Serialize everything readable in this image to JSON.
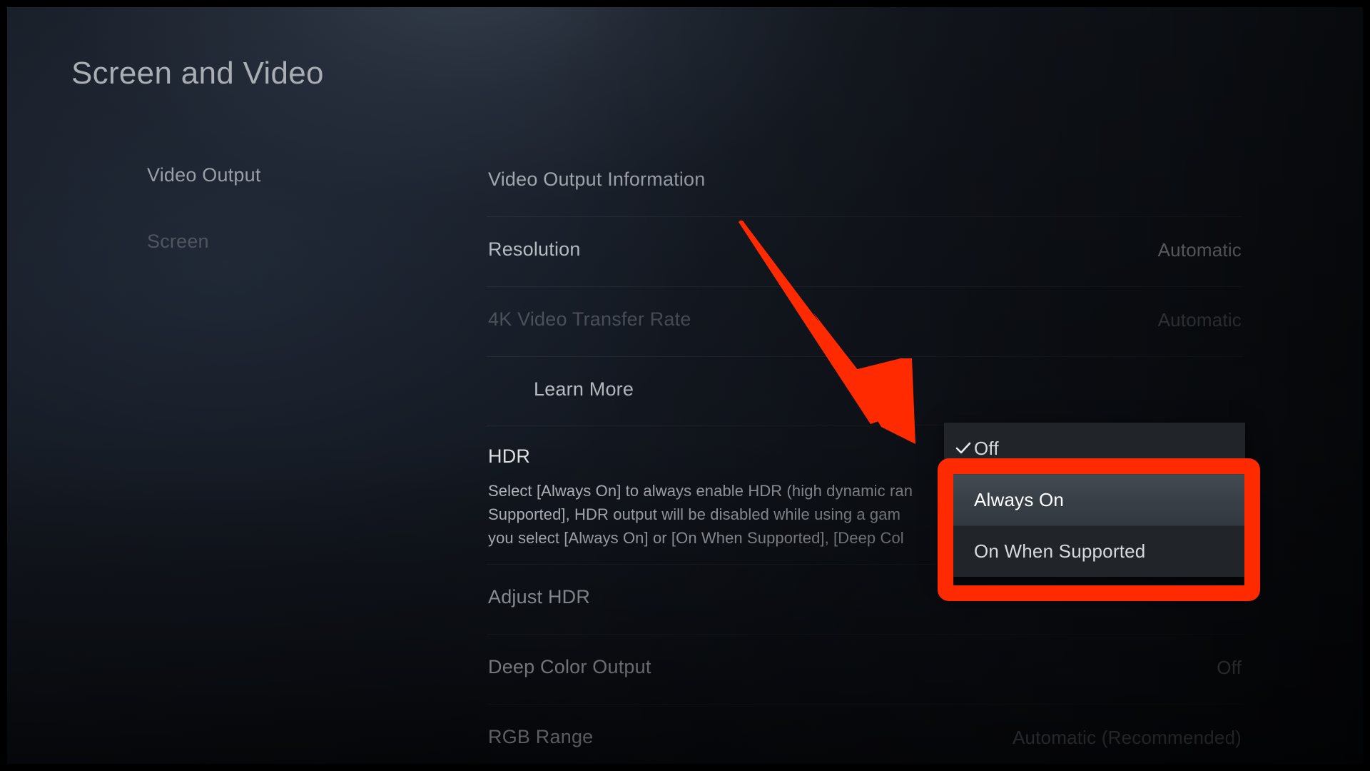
{
  "page": {
    "title": "Screen and Video"
  },
  "sidebar": {
    "items": [
      {
        "label": "Video Output"
      },
      {
        "label": "Screen"
      }
    ]
  },
  "settings": {
    "rows": [
      {
        "label": "Video Output Information",
        "value": ""
      },
      {
        "label": "Resolution",
        "value": "Automatic"
      },
      {
        "label": "4K Video Transfer Rate",
        "value": "Automatic"
      },
      {
        "label": "Learn More",
        "value": ""
      },
      {
        "label": "HDR",
        "value": ""
      },
      {
        "label": "Adjust HDR",
        "value": ""
      },
      {
        "label": "Deep Color Output",
        "value": "Off"
      },
      {
        "label": "RGB Range",
        "value": "Automatic (Recommended)"
      }
    ],
    "hdr_description": "Select [Always On] to always enable HDR (high dynamic ran\nSupported], HDR output will be disabled while using a gam\nyou select [Always On] or [On When Supported], [Deep Col"
  },
  "hdr_dropdown": {
    "options": [
      {
        "label": "Off",
        "checked": true,
        "highlighted": false
      },
      {
        "label": "Always On",
        "checked": false,
        "highlighted": true
      },
      {
        "label": "On When Supported",
        "checked": false,
        "highlighted": false
      }
    ]
  },
  "annotations": {
    "arrow_color": "#ff2a00",
    "box_color": "#ff2a00"
  },
  "colors": {
    "accent_red": "#ff2a00",
    "text_primary": "#e6e8ec",
    "text_secondary": "#b6bac1",
    "text_dim": "#4c5058",
    "highlight_bg": "#3a4048",
    "popup_bg": "#212428",
    "background": "#11151c"
  }
}
